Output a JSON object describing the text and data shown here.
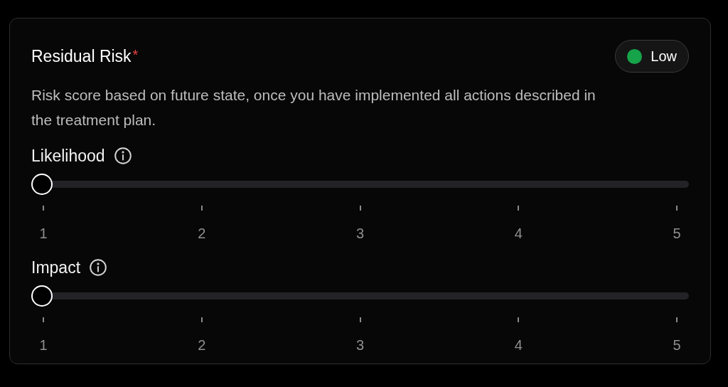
{
  "title": "Residual Risk",
  "required_mark": "*",
  "badge": {
    "label": "Low",
    "color": "#16a34a"
  },
  "description": "Risk score based on future state, once you have implemented all actions described in the treatment plan.",
  "sliders": [
    {
      "label": "Likelihood",
      "level": 0,
      "ticks": [
        "1",
        "2",
        "3",
        "4",
        "5"
      ]
    },
    {
      "label": "Impact",
      "level": 0,
      "ticks": [
        "1",
        "2",
        "3",
        "4",
        "5"
      ]
    }
  ]
}
